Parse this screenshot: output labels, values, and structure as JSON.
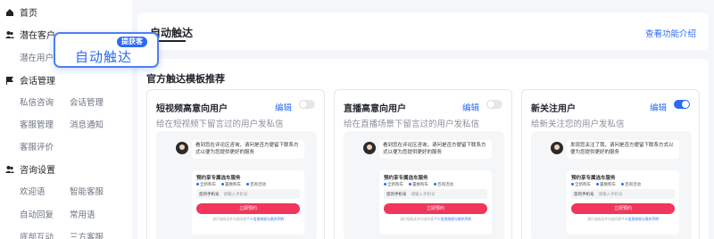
{
  "sidebar": {
    "home": "首页",
    "potential_customers": "潜在客户",
    "potential_users": "潜在用户",
    "conversation_mgmt": "会话管理",
    "dm_consult": "私信咨询",
    "conversation_manage": "会话管理",
    "cs_manage": "客服管理",
    "msg_notify": "消息通知",
    "cs_review": "客服评价",
    "consult_settings": "咨询设置",
    "welcome": "欢迎语",
    "smart_cs": "智能客服",
    "auto_reply": "自动回复",
    "common_phrases": "常用语",
    "bottom_interact": "底部互动",
    "third_party_cs": "三方客服"
  },
  "popup": {
    "label": "自动触达",
    "badge": "提获客"
  },
  "header": {
    "title": "自动触达",
    "feature_link": "查看功能介绍"
  },
  "section": {
    "title": "官方触达模板推荐"
  },
  "cards": [
    {
      "name": "短视频高意向用户",
      "edit": "编辑",
      "enabled": false,
      "desc": "给在短视频下留言过的用户发私信"
    },
    {
      "name": "直播高意向用户",
      "edit": "编辑",
      "enabled": false,
      "desc": "给在直播场景下留言过的用户发私信"
    },
    {
      "name": "新关注用户",
      "edit": "编辑",
      "enabled": true,
      "desc": "给新关注您的用户发私信"
    }
  ],
  "preview_a": {
    "bubble": "看到您在评论区咨询，请问是否方便留下联系方式以便为您提供更好的服务",
    "form_title": "预约享专属选车服务",
    "opts": [
      "全新购车",
      "置换购车",
      "咨询活动"
    ],
    "phone_label": "您的手机号",
    "phone_placeholder": "请输入手机号",
    "submit": "立即预约",
    "agree": "请仔细阅读并勾选同意",
    "agree_link": "个人信息授权与保护声明"
  },
  "preview_b": {
    "bubble": "发现您关注了我，请问是否方便留下联系方式以便为您提供更好的服务",
    "form_title": "预约享专属选车服务",
    "opts": [
      "全新购车",
      "置换购车",
      "咨询活动"
    ],
    "phone_label": "您的手机号",
    "phone_placeholder": "请输入手机号",
    "submit": "立即预约",
    "agree": "请仔细阅读并勾选同意",
    "agree_link": "个人信息授权与保护声明"
  },
  "colors": {
    "accent": "#2b6bf3",
    "submit": "#f1355b"
  }
}
